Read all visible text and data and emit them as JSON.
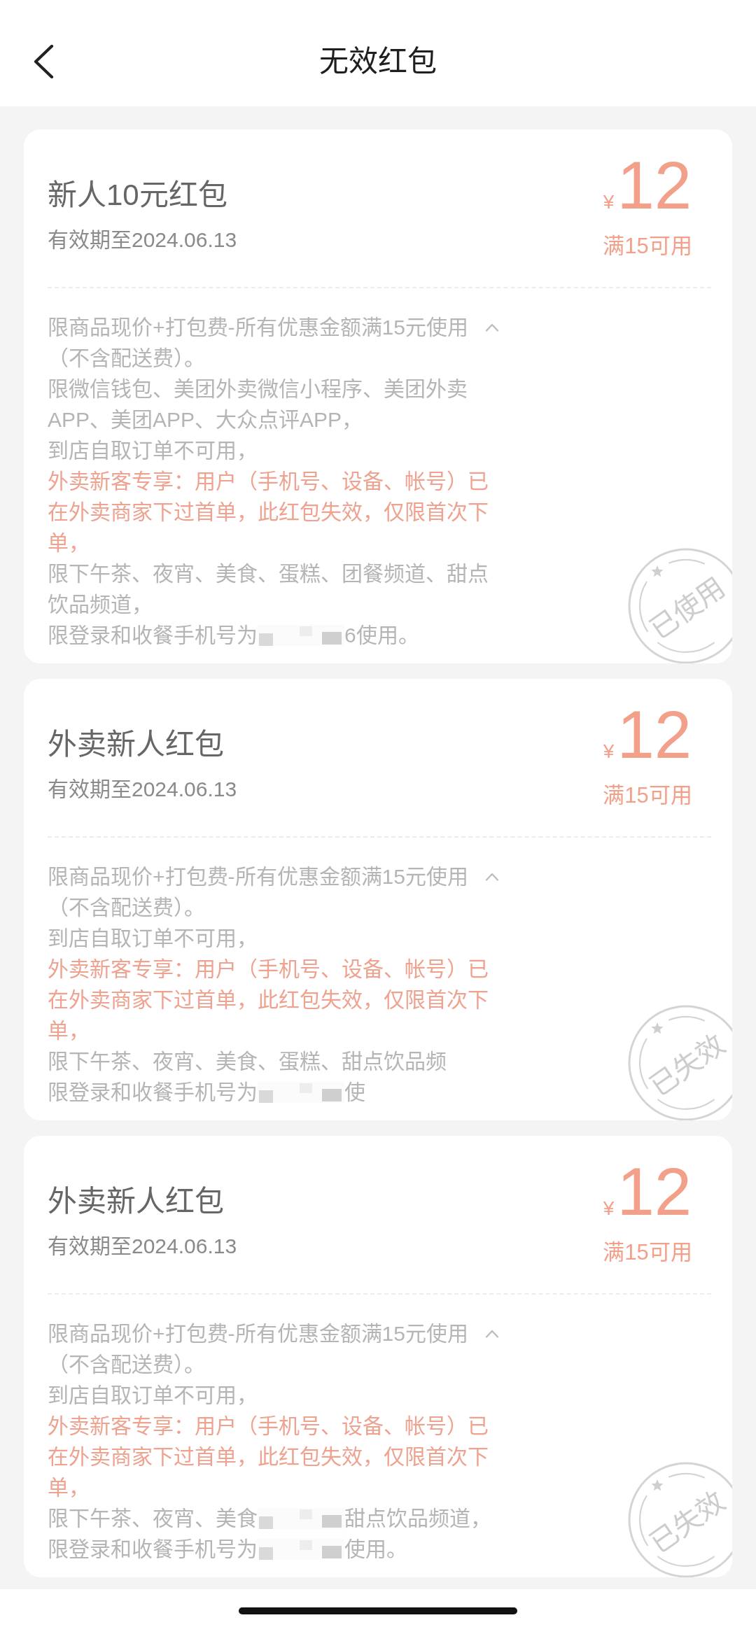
{
  "header": {
    "title": "无效红包"
  },
  "cards": [
    {
      "title": "新人10元红包",
      "validity": "有效期至2024.06.13",
      "currency": "¥",
      "amount": "12",
      "threshold": "满15可用",
      "summary": "限商品现价+打包费-所有优惠金额满15元使用",
      "expanded": true,
      "rules": [
        {
          "kind": "text",
          "text": "（不含配送费）。",
          "highlight": false
        },
        {
          "kind": "text",
          "text": "限微信钱包、美团外卖微信小程序、美团外卖APP、美团APP、大众点评APP，",
          "highlight": false
        },
        {
          "kind": "text",
          "text": "到店自取订单不可用，",
          "highlight": false
        },
        {
          "kind": "text",
          "text": "外卖新客专享：用户（手机号、设备、帐号）已在外卖商家下过首单，此红包失效，仅限首次下单，",
          "highlight": true
        },
        {
          "kind": "text",
          "text": "限下午茶、夜宵、美食、蛋糕、团餐频道、甜点饮品频道，",
          "highlight": false
        },
        {
          "kind": "masked",
          "before": "限登录和收餐手机号为",
          "after": "6使用。",
          "highlight": false
        }
      ],
      "stamp": "已使用"
    },
    {
      "title": "外卖新人红包",
      "validity": "有效期至2024.06.13",
      "currency": "¥",
      "amount": "12",
      "threshold": "满15可用",
      "summary": "限商品现价+打包费-所有优惠金额满15元使用",
      "expanded": true,
      "rules": [
        {
          "kind": "text",
          "text": "（不含配送费）。",
          "highlight": false
        },
        {
          "kind": "text",
          "text": "到店自取订单不可用，",
          "highlight": false
        },
        {
          "kind": "text",
          "text": "外卖新客专享：用户（手机号、设备、帐号）已在外卖商家下过首单，此红包失效，仅限首次下单，",
          "highlight": true
        },
        {
          "kind": "text",
          "text": "限下午茶、夜宵、美食、蛋糕、甜点饮品频",
          "highlight": false
        },
        {
          "kind": "masked",
          "before": "限登录和收餐手机号为",
          "after": "使",
          "highlight": false
        }
      ],
      "stamp": "已失效"
    },
    {
      "title": "外卖新人红包",
      "validity": "有效期至2024.06.13",
      "currency": "¥",
      "amount": "12",
      "threshold": "满15可用",
      "summary": "限商品现价+打包费-所有优惠金额满15元使用",
      "expanded": true,
      "rules": [
        {
          "kind": "text",
          "text": "（不含配送费）。",
          "highlight": false
        },
        {
          "kind": "text",
          "text": "到店自取订单不可用，",
          "highlight": false
        },
        {
          "kind": "text",
          "text": "外卖新客专享：用户（手机号、设备、帐号）已在外卖商家下过首单，此红包失效，仅限首次下单，",
          "highlight": true
        },
        {
          "kind": "masked",
          "before": "限下午茶、夜宵、美食",
          "after": "甜点饮品频道，",
          "highlight": false
        },
        {
          "kind": "masked",
          "before": "限登录和收餐手机号为",
          "after": "使用。",
          "highlight": false
        }
      ],
      "stamp": "已失效"
    }
  ]
}
